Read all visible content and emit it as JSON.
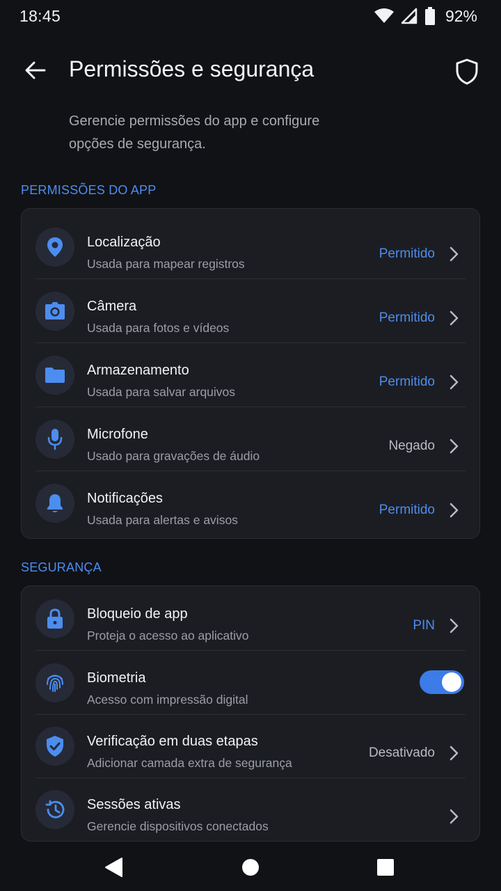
{
  "status_bar": {
    "time": "18:45",
    "battery": "92%"
  },
  "app_bar": {
    "title": "Permissões e segurança"
  },
  "description": "Gerencie permissões do app e configure opções de segurança.",
  "sections": {
    "permissions": {
      "header": "PERMISSÕES DO APP",
      "items": [
        {
          "icon": "location-pin-icon",
          "title": "Localização",
          "subtitle": "Usada para mapear registros",
          "status": "Permitido",
          "status_kind": "allowed"
        },
        {
          "icon": "camera-icon",
          "title": "Câmera",
          "subtitle": "Usada para fotos e vídeos",
          "status": "Permitido",
          "status_kind": "allowed"
        },
        {
          "icon": "folder-icon",
          "title": "Armazenamento",
          "subtitle": "Usada para salvar arquivos",
          "status": "Permitido",
          "status_kind": "allowed"
        },
        {
          "icon": "microphone-icon",
          "title": "Microfone",
          "subtitle": "Usado para gravações de áudio",
          "status": "Negado",
          "status_kind": "denied"
        },
        {
          "icon": "bell-icon",
          "title": "Notificações",
          "subtitle": "Usada para alertas e avisos",
          "status": "Permitido",
          "status_kind": "allowed"
        }
      ]
    },
    "security": {
      "header": "SEGURANÇA",
      "items": [
        {
          "icon": "lock-icon",
          "title": "Bloqueio de app",
          "subtitle": "Proteja o acesso ao aplicativo",
          "status": "PIN",
          "status_kind": "allowed"
        },
        {
          "icon": "fingerprint-icon",
          "title": "Biometria",
          "subtitle": "Acesso com impressão digital",
          "toggle": true
        },
        {
          "icon": "shield-check-icon",
          "title": "Verificação em duas etapas",
          "subtitle": "Adicionar camada extra de segurança",
          "status": "Desativado",
          "status_kind": "muted"
        },
        {
          "icon": "history-icon",
          "title": "Sessões ativas",
          "subtitle": "Gerencie dispositivos conectados",
          "status": ""
        }
      ]
    }
  },
  "colors": {
    "accent": "#4C8DF0",
    "background": "#111216",
    "card": "#1C1D22"
  }
}
